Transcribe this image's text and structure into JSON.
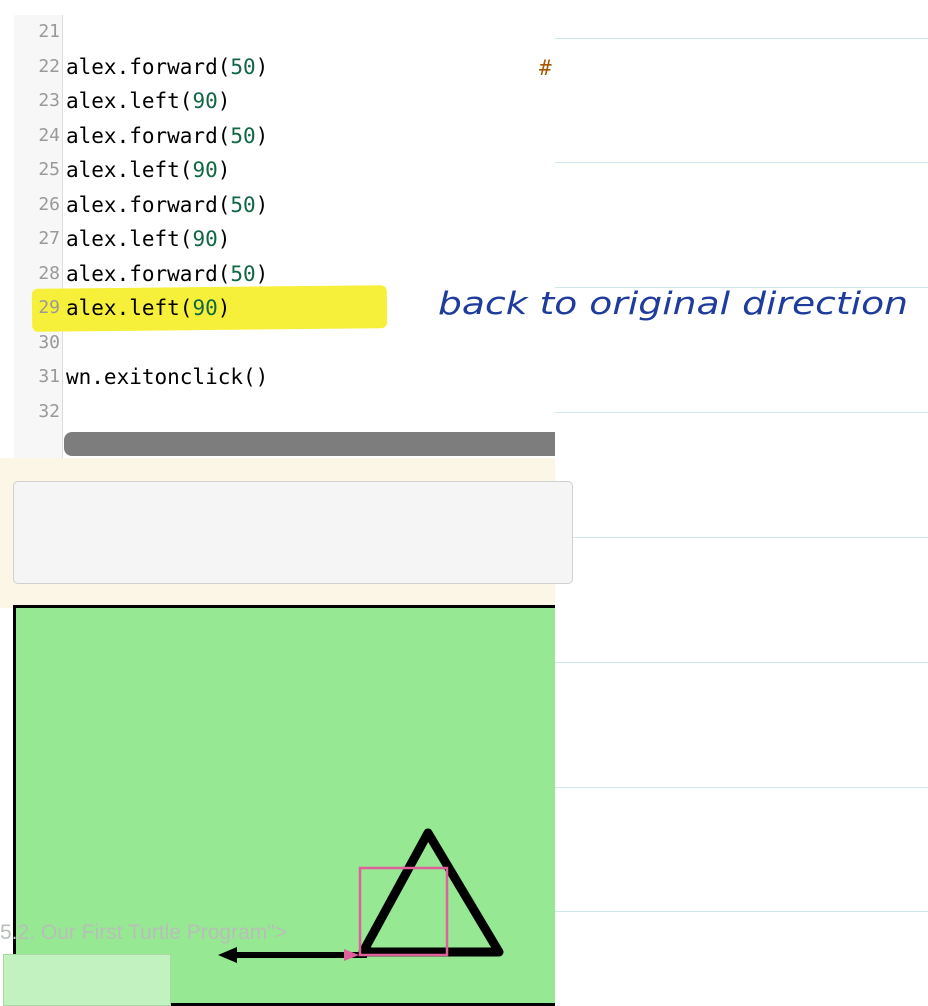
{
  "editor": {
    "lines": [
      {
        "n": "21",
        "parts": []
      },
      {
        "n": "22",
        "parts": [
          {
            "t": "alex.forward("
          },
          {
            "t": "50",
            "num": true
          },
          {
            "t": ")"
          }
        ]
      },
      {
        "n": "23",
        "parts": [
          {
            "t": "alex.left("
          },
          {
            "t": "90",
            "num": true
          },
          {
            "t": ")"
          }
        ]
      },
      {
        "n": "24",
        "parts": [
          {
            "t": "alex.forward("
          },
          {
            "t": "50",
            "num": true
          },
          {
            "t": ")"
          }
        ]
      },
      {
        "n": "25",
        "parts": [
          {
            "t": "alex.left("
          },
          {
            "t": "90",
            "num": true
          },
          {
            "t": ")"
          }
        ]
      },
      {
        "n": "26",
        "parts": [
          {
            "t": "alex.forward("
          },
          {
            "t": "50",
            "num": true
          },
          {
            "t": ")"
          }
        ]
      },
      {
        "n": "27",
        "parts": [
          {
            "t": "alex.left("
          },
          {
            "t": "90",
            "num": true
          },
          {
            "t": ")"
          }
        ]
      },
      {
        "n": "28",
        "parts": [
          {
            "t": "alex.forward("
          },
          {
            "t": "50",
            "num": true
          },
          {
            "t": ")"
          }
        ]
      },
      {
        "n": "29",
        "parts": [
          {
            "t": "alex.left("
          },
          {
            "t": "90",
            "num": true
          },
          {
            "t": ")"
          }
        ]
      },
      {
        "n": "30",
        "parts": []
      },
      {
        "n": "31",
        "parts": [
          {
            "t": "wn.exitonclick()"
          }
        ]
      },
      {
        "n": "32",
        "parts": []
      }
    ],
    "comment_hash": "#",
    "highlighted_line": "29"
  },
  "annotation": {
    "text": "back to original direction"
  },
  "caption": {
    "text": "5.2. Our First Turtle Program\">"
  },
  "colors": {
    "canvas_bg": "#96e893",
    "highlight": "#f7f03a",
    "ink": "#1f3c9c",
    "square": "#e0609c"
  }
}
